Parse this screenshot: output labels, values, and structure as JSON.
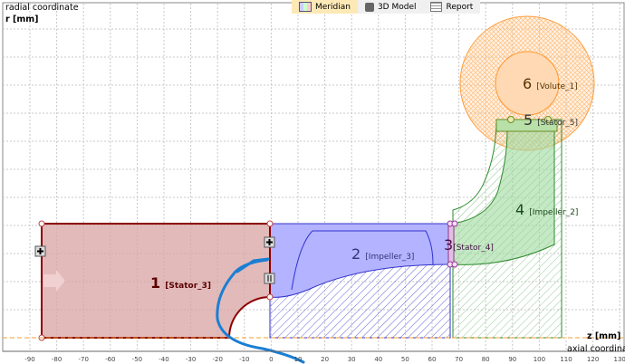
{
  "toolbar": {
    "tabs": [
      {
        "label": "Meridian",
        "active": true
      },
      {
        "label": "3D Model"
      },
      {
        "label": "Report"
      }
    ]
  },
  "axes": {
    "y_label": "radial coordinate",
    "y_unit": "r [mm]",
    "x_unit": "z [mm]",
    "x_label": "axial coordinate",
    "x_ticks": [
      "-90",
      "-80",
      "-70",
      "-60",
      "-50",
      "-40",
      "-30",
      "-20",
      "-10",
      "0",
      "10",
      "20",
      "30",
      "40",
      "50",
      "60",
      "70",
      "80",
      "90",
      "100",
      "110",
      "120",
      "130"
    ]
  },
  "components": [
    {
      "num": "1",
      "name": "[Stator_3]",
      "color": "#8b0000"
    },
    {
      "num": "2",
      "name": "[Impeller_3]",
      "color": "#3333cc"
    },
    {
      "num": "3",
      "name": "[Stator_4]",
      "color": "#8b3a8b"
    },
    {
      "num": "4",
      "name": "[Impeller_2]",
      "color": "#2e8b2e"
    },
    {
      "num": "5",
      "name": "[Stator_5]",
      "color": "#556b2f"
    },
    {
      "num": "6",
      "name": "[Volute_1]",
      "color": "#ff9933"
    }
  ]
}
